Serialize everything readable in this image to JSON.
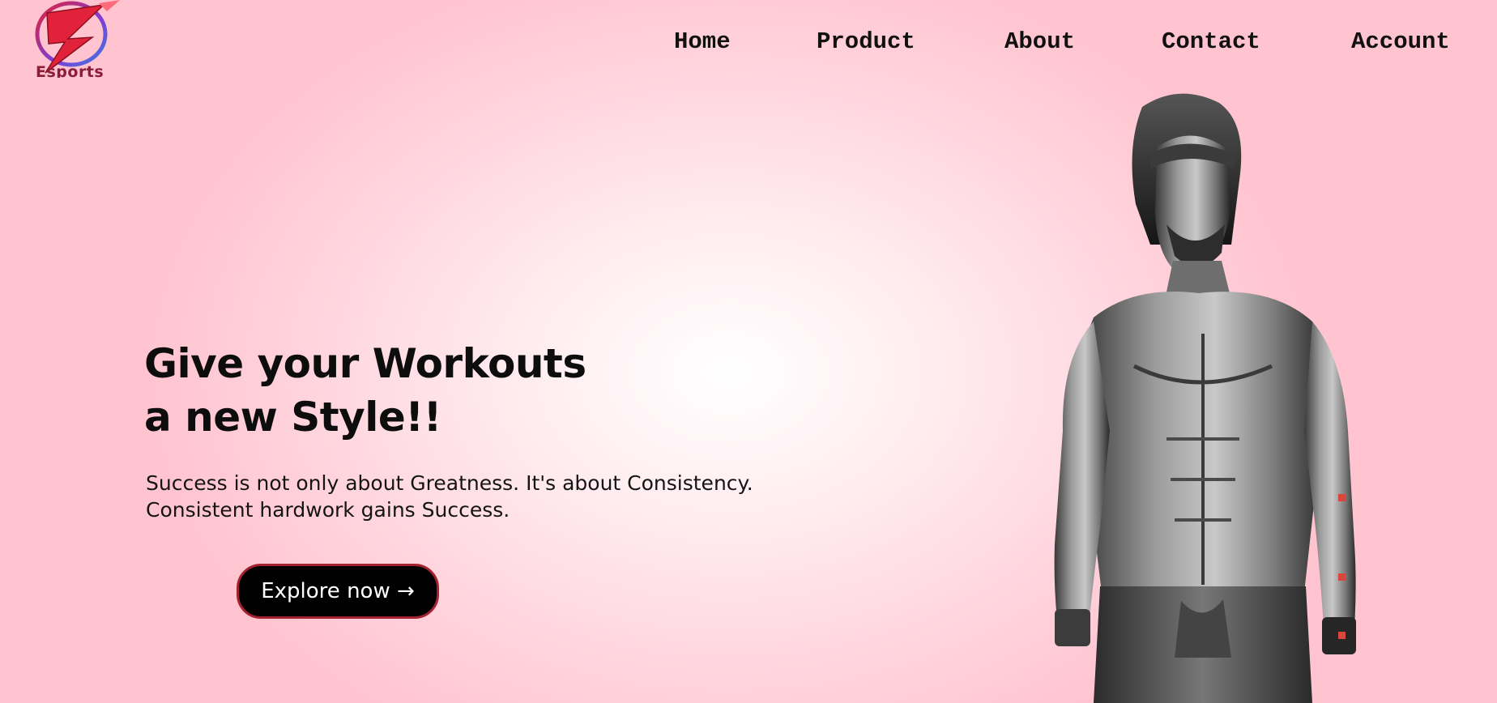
{
  "brand": {
    "logo_text": "Esports",
    "logo_colors": [
      "#e1223a",
      "#7a3fd6",
      "#3f7be0"
    ]
  },
  "nav": {
    "items": [
      {
        "label": "Home"
      },
      {
        "label": "Product"
      },
      {
        "label": "About"
      },
      {
        "label": "Contact"
      },
      {
        "label": "Account"
      }
    ]
  },
  "hero": {
    "title_line1": "Give your Workouts",
    "title_line2": "a new Style!!",
    "subtitle_line1": "Success is not only about Greatness. It's about Consistency.",
    "subtitle_line2": "Consistent hardwork gains Success.",
    "cta_label": "Explore now →",
    "image": "black-and-white photo of a muscular athlete with headband"
  },
  "colors": {
    "background_center": "#ffffff",
    "background_edge": "#ffc4d0",
    "button_bg": "#000000",
    "button_border": "#a4222f",
    "slider_dot": "#d8463c"
  }
}
